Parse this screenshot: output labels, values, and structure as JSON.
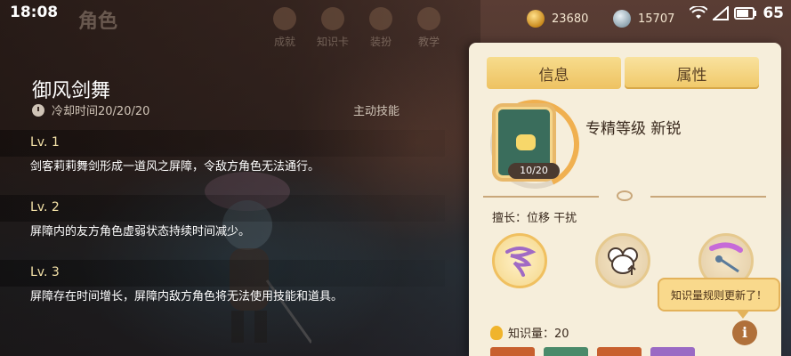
{
  "status": {
    "time": "18:08",
    "battery": "65",
    "gold": "23680",
    "silver": "15707"
  },
  "background": {
    "title": "角色",
    "nav": [
      "成就",
      "知识卡",
      "装扮",
      "教学"
    ]
  },
  "skill": {
    "name": "御风剑舞",
    "cooldown": "冷却时间20/20/20",
    "type": "主动技能",
    "levels": [
      {
        "label": "Lv. 1",
        "text": "剑客莉莉舞剑形成一道风之屏障，令敌方角色无法通行。"
      },
      {
        "label": "Lv. 2",
        "text": "屏障内的友方角色虚弱状态持续时间减少。"
      },
      {
        "label": "Lv. 3",
        "text": "屏障存在时间增长，屏障内敌方角色将无法使用技能和道具。"
      }
    ]
  },
  "panel": {
    "tabs": [
      "信息",
      "属性"
    ],
    "level_progress": "10/20",
    "mastery": "专精等级  新锐",
    "specialty": "擅长：位移  干扰",
    "tooltip": "知识量规则更新了！",
    "knowledge": "知识量：20",
    "info_glyph": "i"
  },
  "icons": {
    "status": [
      "wifi-icon",
      "signal-icon",
      "battery-icon"
    ],
    "skills": [
      "whirlwind-skill-icon",
      "mouse-arrow-skill-icon",
      "rapier-skill-icon"
    ]
  },
  "colors": {
    "accent": "#f0c868",
    "panel_bg": "#f6eedb",
    "level_text": "#f4e2a8",
    "card_green": "#3a6d5c"
  }
}
